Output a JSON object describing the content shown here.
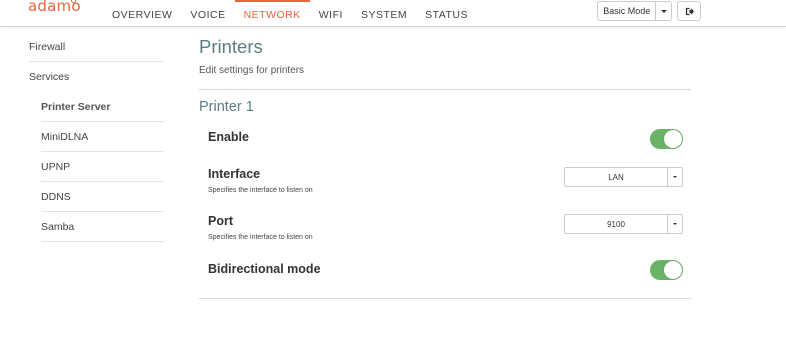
{
  "brand": {
    "logo_text": "adamo",
    "accent": "#e8643c"
  },
  "nav": {
    "items": [
      {
        "label": "OVERVIEW",
        "active": false
      },
      {
        "label": "VOICE",
        "active": false
      },
      {
        "label": "NETWORK",
        "active": true
      },
      {
        "label": "WIFI",
        "active": false
      },
      {
        "label": "SYSTEM",
        "active": false
      },
      {
        "label": "STATUS",
        "active": false
      }
    ],
    "mode_select": {
      "value": "Basic Mode"
    },
    "logout_icon": "sign-out-icon"
  },
  "sidebar": {
    "top_item": "Firewall",
    "section": "Services",
    "items": [
      {
        "label": "Printer Server",
        "active": true
      },
      {
        "label": "MiniDLNA",
        "active": false
      },
      {
        "label": "UPNP",
        "active": false
      },
      {
        "label": "DDNS",
        "active": false
      },
      {
        "label": "Samba",
        "active": false
      }
    ]
  },
  "page": {
    "title": "Printers",
    "subtitle": "Edit settings for printers",
    "title_color": "#5a7f80"
  },
  "printer": {
    "section_title": "Printer 1",
    "enable": {
      "label": "Enable",
      "on": true
    },
    "interface": {
      "label": "Interface",
      "description": "Specifies the interface to listen on",
      "value": "LAN"
    },
    "port": {
      "label": "Port",
      "description": "Specifies the interface to listen on",
      "value": "9100"
    },
    "bidirectional": {
      "label": "Bidirectional mode",
      "on": true
    },
    "toggle_color": "#6ab266"
  }
}
